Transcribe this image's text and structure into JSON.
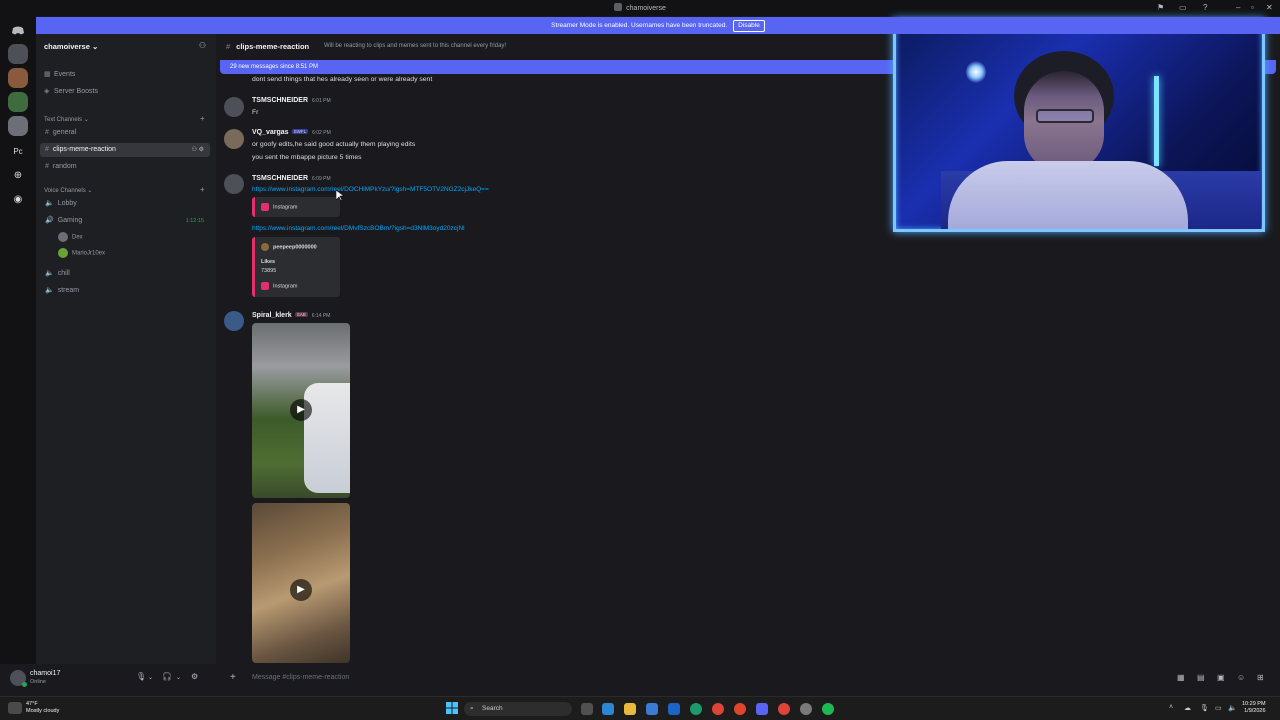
{
  "window": {
    "title": "chamoiverse"
  },
  "banner": {
    "text": "Streamer Mode is enabled. Usernames have been truncated.",
    "disable_label": "Disable"
  },
  "guilds": {
    "items": [
      "Pc"
    ]
  },
  "sidebar": {
    "server_name": "chamoiverse ⌄",
    "top_items": [
      "Events",
      "Server Boosts"
    ],
    "text_category": "Text Channels ⌄",
    "text_channels": [
      "general",
      "clips-meme-reaction",
      "random"
    ],
    "voice_category": "Voice Channels ⌄",
    "voice_channels": [
      "Lobby",
      "Gaming",
      "chill",
      "stream"
    ],
    "gaming_timer": "1:12:15",
    "voice_users": [
      "Dex",
      "MarioJr10ex"
    ]
  },
  "user_panel": {
    "name": "chamoi17",
    "status": "Online"
  },
  "channel": {
    "name": "clips-meme-reaction",
    "topic": "Will be reacting to clips and memes sent to this channel every friday!",
    "new_messages": "29 new messages since 8:51 PM"
  },
  "messages": {
    "m0_text": "dont send things that hes already seen or were already sent",
    "m1_author": "TSMSCHNEIDER",
    "m1_time": "6:01 PM",
    "m1_text": "Fr",
    "m2_author": "VQ_vargas",
    "m2_tag": "SWFL",
    "m2_time": "6:02 PM",
    "m2_text1": "or goofy edits,he said good actually them playing edits",
    "m2_text2": "you sent the mbappe picture 5 times",
    "m3_author": "TSMSCHNEIDER",
    "m3_time": "6:09 PM",
    "m3_link1": "https://www.instagram.com/reel/DOCHiMPkYzu/?igsh=MTF5OTV2NGZ2cjJkeQ==",
    "m3_embed1": "Instagram",
    "m3_link2": "https://www.instagram.com/reel/DMvfSzcBOBm/?igsh=d3NlM3oyd20zcjNl",
    "m3_embed2_author": "peepeep0000000",
    "m3_embed2_likes_label": "Likes",
    "m3_embed2_likes": "73895",
    "m3_embed2_footer": "Instagram",
    "m4_author": "Spiral_klerk",
    "m4_tag": "SAB",
    "m4_time": "6:14 PM"
  },
  "composer": {
    "placeholder": "Message #clips-meme-reaction"
  },
  "taskbar": {
    "temp": "47°F",
    "weather": "Mostly cloudy",
    "search": "Search",
    "time": "10:29 PM",
    "date": "1/9/2026"
  },
  "colors": {
    "accent": "#5865f2",
    "online": "#23a55a",
    "link": "#00a8fc",
    "instagram": "#e1306c"
  },
  "icons": [
    "discord-icon",
    "hash-icon",
    "speaker-icon",
    "add-member-icon",
    "settings-icon",
    "mic-icon",
    "headphones-icon",
    "play-icon",
    "windows-start-icon",
    "search-icon",
    "spotify-icon"
  ]
}
